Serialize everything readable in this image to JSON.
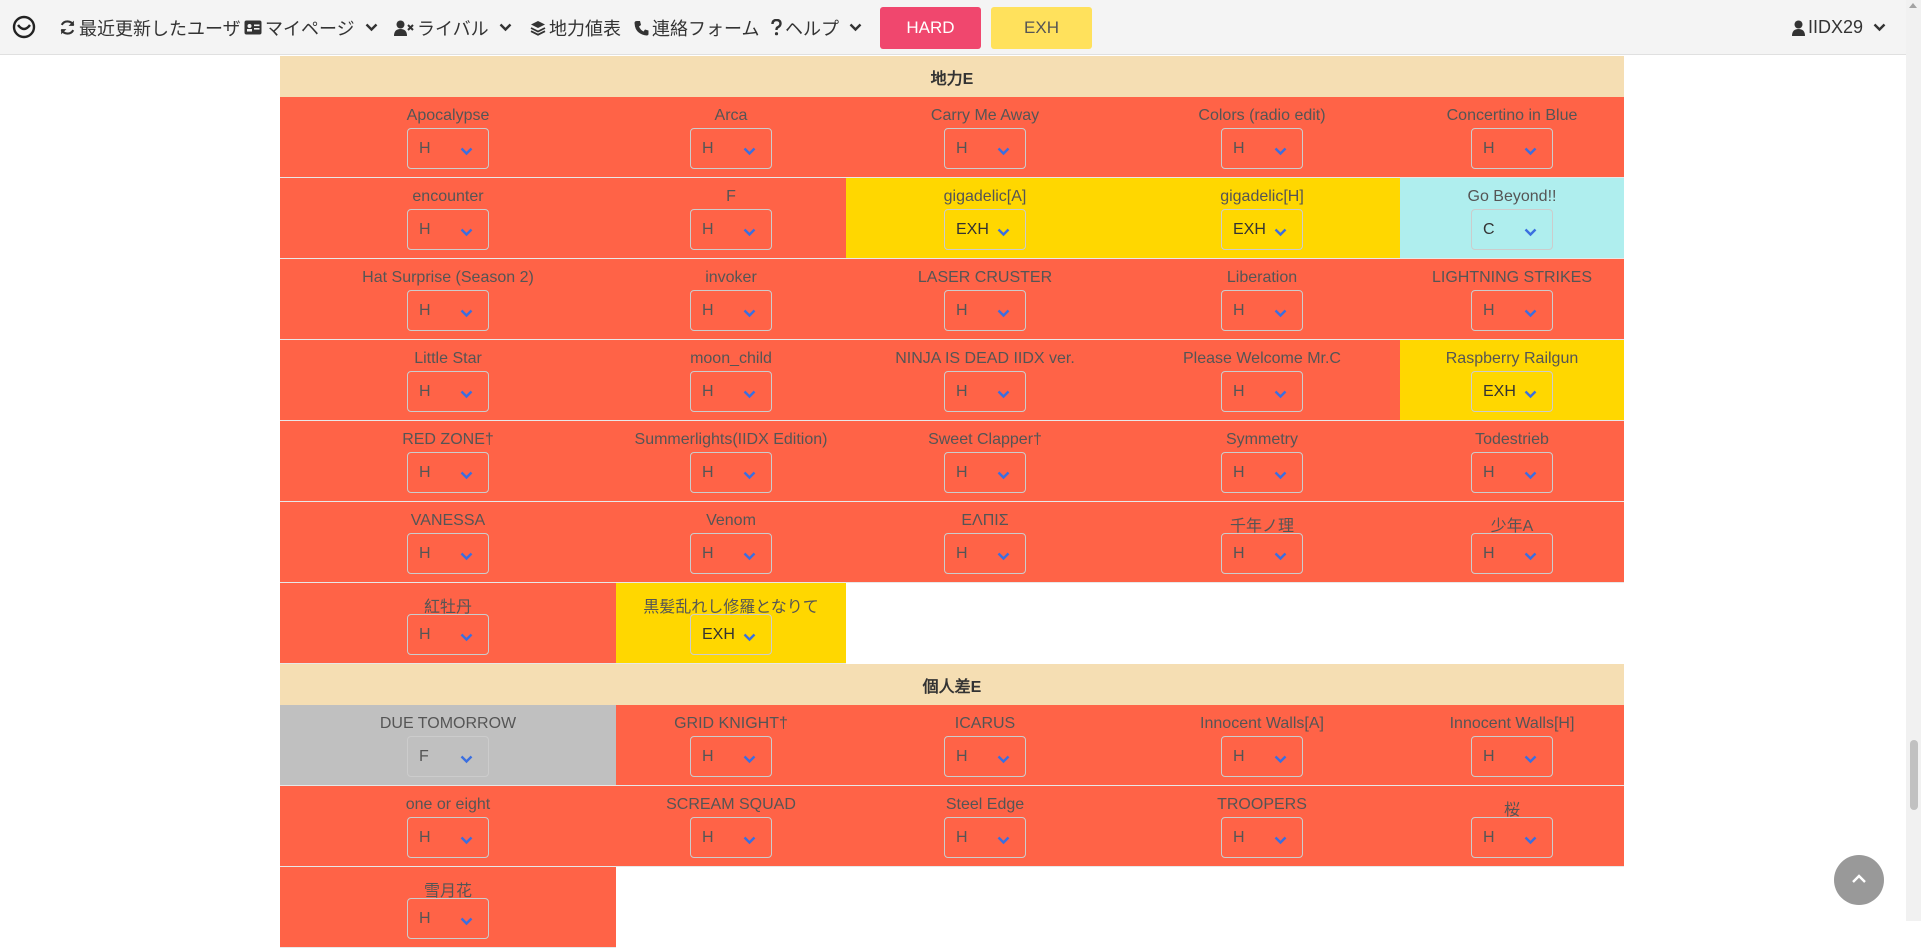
{
  "navbar": {
    "recent_users": "最近更新したユーザ",
    "mypage": "マイページ",
    "rival": "ライバル",
    "table": "地力値表",
    "contact": "連絡フォーム",
    "help": "ヘルプ",
    "hard_button": "HARD",
    "exh_button": "EXH",
    "user": "IIDX29"
  },
  "sections": [
    {
      "title": "地力E",
      "songs": [
        {
          "title": "Apocalypse",
          "lamp": "H"
        },
        {
          "title": "Arca",
          "lamp": "H"
        },
        {
          "title": "Carry Me Away",
          "lamp": "H"
        },
        {
          "title": "Colors (radio edit)",
          "lamp": "H"
        },
        {
          "title": "Concertino in Blue",
          "lamp": "H"
        },
        {
          "title": "encounter",
          "lamp": "H"
        },
        {
          "title": "F",
          "lamp": "H"
        },
        {
          "title": "gigadelic[A]",
          "lamp": "EXH"
        },
        {
          "title": "gigadelic[H]",
          "lamp": "EXH"
        },
        {
          "title": "Go Beyond!!",
          "lamp": "C"
        },
        {
          "title": "Hat Surprise (Season 2)",
          "lamp": "H"
        },
        {
          "title": "invoker",
          "lamp": "H"
        },
        {
          "title": "LASER CRUSTER",
          "lamp": "H"
        },
        {
          "title": "Liberation",
          "lamp": "H"
        },
        {
          "title": "LIGHTNING STRIKES",
          "lamp": "H"
        },
        {
          "title": "Little Star",
          "lamp": "H"
        },
        {
          "title": "moon_child",
          "lamp": "H"
        },
        {
          "title": "NINJA IS DEAD IIDX ver.",
          "lamp": "H"
        },
        {
          "title": "Please Welcome Mr.C",
          "lamp": "H"
        },
        {
          "title": "Raspberry Railgun",
          "lamp": "EXH"
        },
        {
          "title": "RED ZONE†",
          "lamp": "H"
        },
        {
          "title": "Summerlights(IIDX Edition)",
          "lamp": "H"
        },
        {
          "title": "Sweet Clapper†",
          "lamp": "H"
        },
        {
          "title": "Symmetry",
          "lamp": "H"
        },
        {
          "title": "Todestrieb",
          "lamp": "H"
        },
        {
          "title": "VANESSA",
          "lamp": "H"
        },
        {
          "title": "Venom",
          "lamp": "H"
        },
        {
          "title": "ΕΛΠΙΣ",
          "lamp": "H"
        },
        {
          "title": "千年ノ理",
          "lamp": "H"
        },
        {
          "title": "少年A",
          "lamp": "H"
        },
        {
          "title": "紅牡丹",
          "lamp": "H"
        },
        {
          "title": "黒髪乱れし修羅となりて",
          "lamp": "EXH"
        }
      ]
    },
    {
      "title": "個人差E",
      "songs": [
        {
          "title": "DUE TOMORROW",
          "lamp": "F"
        },
        {
          "title": "GRID KNIGHT†",
          "lamp": "H"
        },
        {
          "title": "ICARUS",
          "lamp": "H"
        },
        {
          "title": "Innocent Walls[A]",
          "lamp": "H"
        },
        {
          "title": "Innocent Walls[H]",
          "lamp": "H"
        },
        {
          "title": "one or eight",
          "lamp": "H"
        },
        {
          "title": "SCREAM SQUAD",
          "lamp": "H"
        },
        {
          "title": "Steel Edge",
          "lamp": "H"
        },
        {
          "title": "TROOPERS",
          "lamp": "H"
        },
        {
          "title": "桜",
          "lamp": "H"
        },
        {
          "title": "雪月花",
          "lamp": "H"
        }
      ]
    }
  ],
  "colors": {
    "H": "#ff6347",
    "EXH": "#ffd700",
    "C": "#afeeee",
    "F": "#c0c0c0",
    "section_header": "#f5deb3",
    "hard_button": "#f0476e",
    "exh_button": "#ffe15c"
  }
}
